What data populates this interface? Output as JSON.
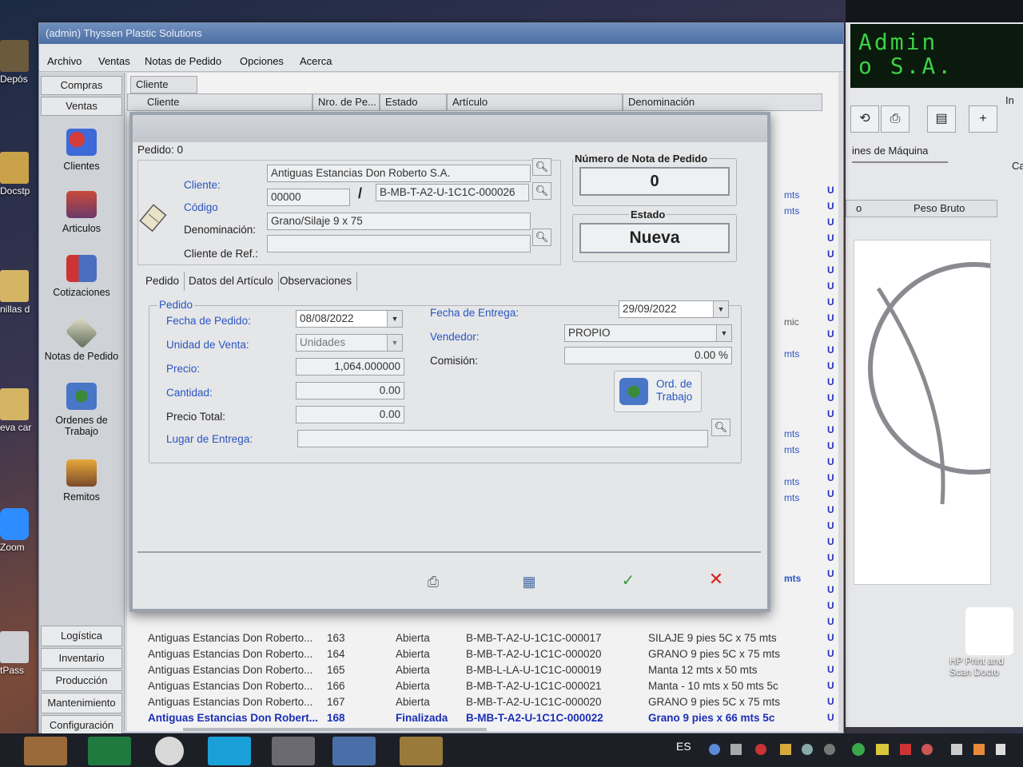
{
  "desktop": {
    "icons": [
      "Depós",
      "Docstp",
      "nillas d",
      "eva car",
      "Zoom",
      "tPass"
    ],
    "hp_label": "HP Print and Scan Docto"
  },
  "main_window": {
    "title": "(admin) Thyssen Plastic Solutions",
    "menu": [
      "Archivo",
      "Ventas",
      "Notas de Pedido",
      "Opciones",
      "Acerca"
    ],
    "nav_top": [
      "Compras",
      "Ventas"
    ],
    "nav_items": [
      "Clientes",
      "Articulos",
      "Cotizaciones",
      "Notas de Pedido",
      "Ordenes de Trabajo",
      "Remitos"
    ],
    "nav_bottom": [
      "Logística",
      "Inventario",
      "Producción",
      "Mantenimiento",
      "Configuración"
    ],
    "grid": {
      "group_field": "Cliente",
      "columns": [
        "Cliente",
        "Nro. de Pe...",
        "Estado",
        "Artículo",
        "Denominación"
      ],
      "rows": [
        {
          "cliente": "Antiguas Estancias Don Roberto...",
          "nro": "163",
          "estado": "Abierta",
          "articulo": "B-MB-T-A2-U-1C1C-000017",
          "denominacion": "SILAJE 9 pies 5C x 75 mts"
        },
        {
          "cliente": "Antiguas Estancias Don Roberto...",
          "nro": "164",
          "estado": "Abierta",
          "articulo": "B-MB-T-A2-U-1C1C-000020",
          "denominacion": "GRANO 9 pies 5C x 75 mts"
        },
        {
          "cliente": "Antiguas Estancias Don Roberto...",
          "nro": "165",
          "estado": "Abierta",
          "articulo": "B-MB-L-LA-U-1C1C-000019",
          "denominacion": "Manta 12 mts x 50 mts"
        },
        {
          "cliente": "Antiguas Estancias Don Roberto...",
          "nro": "166",
          "estado": "Abierta",
          "articulo": "B-MB-T-A2-U-1C1C-000021",
          "denominacion": "Manta - 10 mts x 50 mts 5c"
        },
        {
          "cliente": "Antiguas Estancias Don Roberto...",
          "nro": "167",
          "estado": "Abierta",
          "articulo": "B-MB-T-A2-U-1C1C-000020",
          "denominacion": "GRANO 9 pies 5C x 75 mts"
        },
        {
          "cliente": "Antiguas Estancias Don Robert...",
          "nro": "168",
          "estado": "Finalizada",
          "articulo": "B-MB-T-A2-U-1C1C-000022",
          "denominacion": "Grano 9 pies x 66 mts 5c"
        }
      ],
      "side_units": [
        "mts",
        "mts",
        "mic",
        "mts",
        "mts",
        "mts",
        "mts",
        "mts",
        "mts"
      ],
      "u_flag": "U"
    }
  },
  "right_window": {
    "lcd_line1": "Admin",
    "lcd_line2": "o S.A.",
    "tab_label": "ines de Máquina",
    "col_label": "Peso Bruto",
    "col_short": "o",
    "edge_labels": [
      "In",
      "Ca"
    ],
    "plus": "+"
  },
  "dialog": {
    "title": "Pedido: 0",
    "cliente_label": "Cliente:",
    "cliente_value": "Antiguas Estancias Don Roberto S.A.",
    "codigo_label": "Código",
    "codigo_value": "00000",
    "slash": "/",
    "articulo_code": "B-MB-T-A2-U-1C1C-000026",
    "denominacion_label": "Denominación:",
    "denominacion_value": "Grano/Silaje 9 x 75",
    "cliente_ref_label": "Cliente de Ref.:",
    "cliente_ref_value": "",
    "numero_label": "Número de Nota de Pedido",
    "numero_value": "0",
    "estado_label": "Estado",
    "estado_value": "Nueva",
    "tabs": [
      "Pedido",
      "Datos del Artículo",
      "Observaciones"
    ],
    "group_label": "Pedido",
    "fecha_pedido_label": "Fecha de Pedido:",
    "fecha_pedido_value": "08/08/2022",
    "unidad_label": "Unidad de Venta:",
    "unidad_value": "Unidades",
    "precio_label": "Precio:",
    "precio_value": "1,064.000000",
    "cantidad_label": "Cantidad:",
    "cantidad_value": "0.00",
    "precio_total_label": "Precio Total:",
    "precio_total_value": "0.00",
    "lugar_label": "Lugar de Entrega:",
    "lugar_value": "",
    "fecha_entrega_label": "Fecha de Entrega:",
    "fecha_entrega_value": "29/09/2022",
    "vendedor_label": "Vendedor:",
    "vendedor_value": "PROPIO",
    "comision_label": "Comisión:",
    "comision_value": "0.00 %",
    "ord_trabajo_label": "Ord. de Trabajo"
  },
  "taskbar": {
    "lang": "ES"
  },
  "colors": {
    "accent_blue": "#2a55c0",
    "selected_row": "#1b2fb5",
    "ok_green": "#3a9a3a",
    "cancel_red": "#d42020",
    "lcd_green": "#3cd046"
  }
}
